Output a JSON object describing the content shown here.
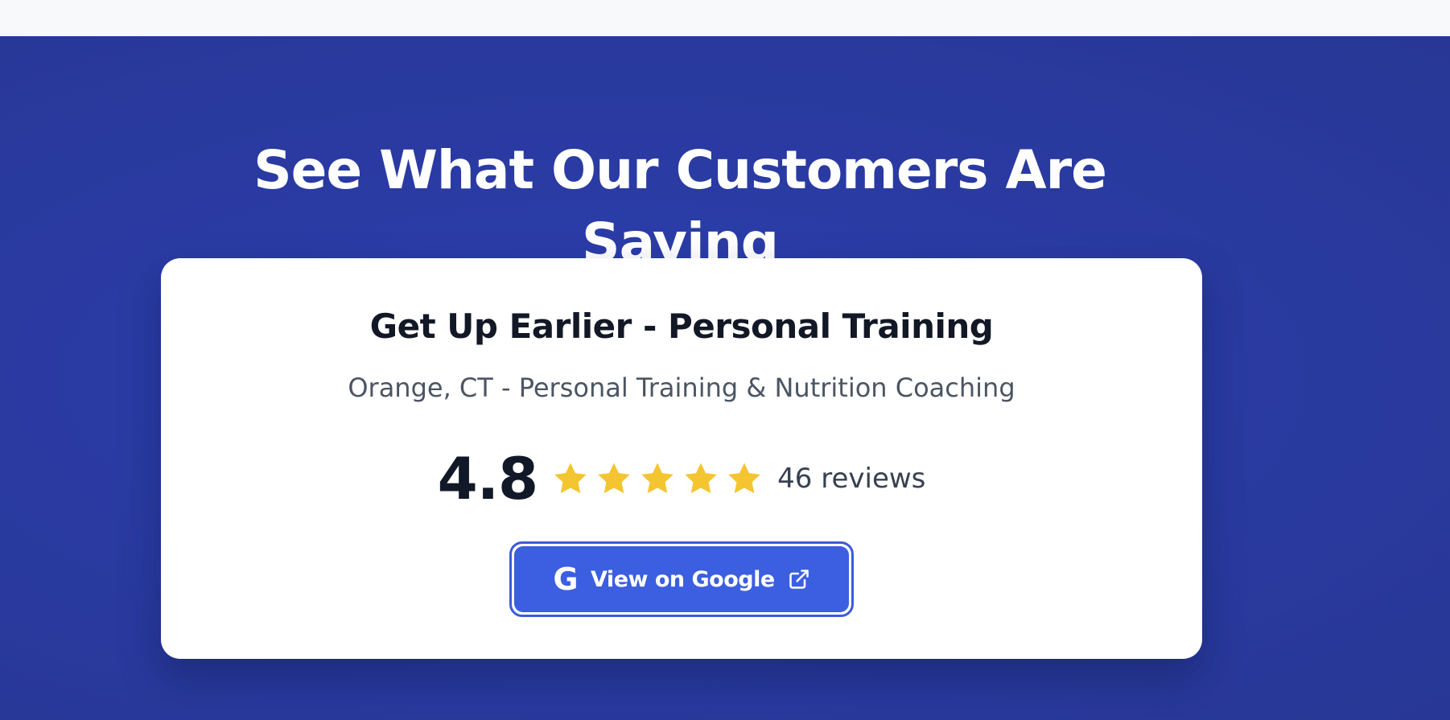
{
  "section": {
    "heading": "See What Our Customers Are Saying"
  },
  "card": {
    "business_name": "Get Up Earlier - Personal Training",
    "subtitle": "Orange, CT - Personal Training & Nutrition Coaching",
    "rating": "4.8",
    "stars": 5,
    "review_count": "46 reviews",
    "button_label": "View on Google",
    "button_icon": "G"
  },
  "colors": {
    "section_bg": "#2a3ba4",
    "button_bg": "#3b5fe0",
    "star": "#f4c531"
  }
}
